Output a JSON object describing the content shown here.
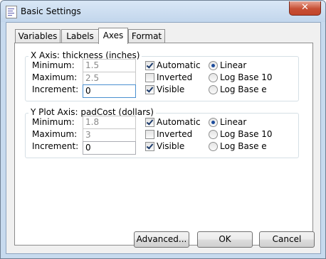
{
  "window": {
    "title": "Basic Settings",
    "close_symbol": "✕"
  },
  "tabs": [
    "Variables",
    "Labels",
    "Axes",
    "Format"
  ],
  "active_tab": "Axes",
  "x_axis": {
    "title": "X Axis: thickness (inches)",
    "minimum_label": "Minimum:",
    "minimum_value": "1.5",
    "maximum_label": "Maximum:",
    "maximum_value": "2.5",
    "increment_label": "Increment:",
    "increment_value": "0",
    "automatic_label": "Automatic",
    "automatic_checked": true,
    "inverted_label": "Inverted",
    "inverted_checked": false,
    "visible_label": "Visible",
    "visible_checked": true,
    "scale_options": [
      "Linear",
      "Log Base 10",
      "Log Base e"
    ],
    "scale_selected": "Linear"
  },
  "y_axis": {
    "title": "Y Plot Axis: padCost (dollars)",
    "minimum_label": "Minimum:",
    "minimum_value": "1.8",
    "maximum_label": "Maximum:",
    "maximum_value": "3",
    "increment_label": "Increment:",
    "increment_value": "0",
    "automatic_label": "Automatic",
    "automatic_checked": true,
    "inverted_label": "Inverted",
    "inverted_checked": false,
    "visible_label": "Visible",
    "visible_checked": true,
    "scale_options": [
      "Linear",
      "Log Base 10",
      "Log Base e"
    ],
    "scale_selected": "Linear"
  },
  "buttons": {
    "advanced": "Advanced...",
    "ok": "OK",
    "cancel": "Cancel"
  },
  "colors": {
    "title_bar": "#c7daee",
    "close_button": "#c74f34",
    "radio_dot": "#1d4c9c",
    "focus_border": "#4a90d0"
  },
  "icons": {
    "app": "settings-app-icon",
    "close": "close-icon"
  }
}
